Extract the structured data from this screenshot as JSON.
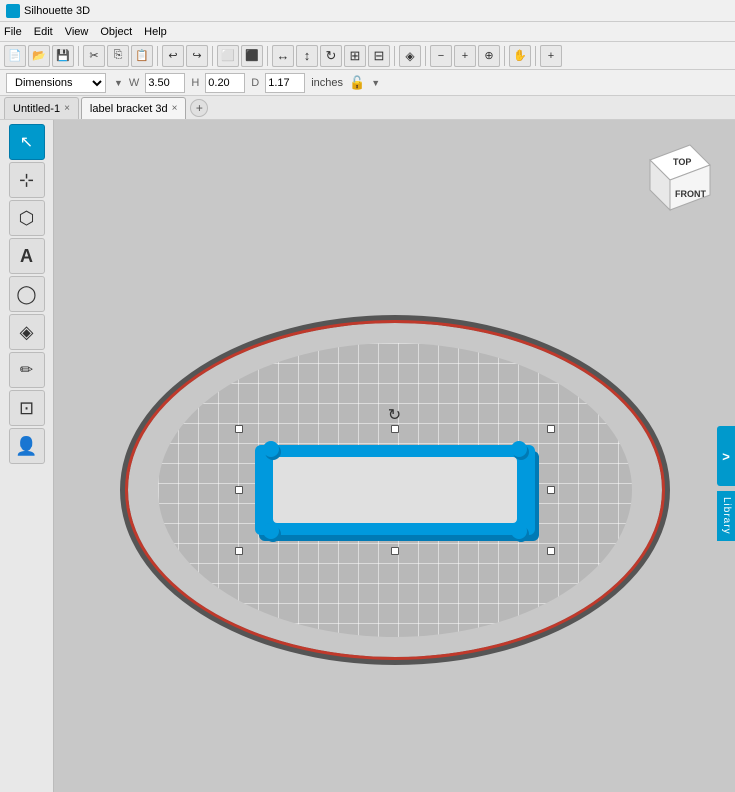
{
  "app": {
    "title": "Silhouette 3D",
    "icon": "S3D"
  },
  "menu": {
    "items": [
      "File",
      "Edit",
      "View",
      "Object",
      "Help"
    ]
  },
  "toolbar": {
    "buttons": [
      {
        "name": "new",
        "icon": "📄"
      },
      {
        "name": "open",
        "icon": "📂"
      },
      {
        "name": "save",
        "icon": "💾"
      },
      {
        "name": "cut",
        "icon": "✂"
      },
      {
        "name": "copy",
        "icon": "⎘"
      },
      {
        "name": "paste",
        "icon": "📋"
      },
      {
        "name": "undo",
        "icon": "↩"
      },
      {
        "name": "redo",
        "icon": "↪"
      },
      {
        "name": "select-rect",
        "icon": "⬜"
      },
      {
        "name": "select-all",
        "icon": "⬛"
      },
      {
        "name": "mirror-h",
        "icon": "↔"
      },
      {
        "name": "mirror-v",
        "icon": "↕"
      },
      {
        "name": "rotate",
        "icon": "↻"
      },
      {
        "name": "group",
        "icon": "⊞"
      },
      {
        "name": "ungroup",
        "icon": "⊟"
      },
      {
        "name": "align",
        "icon": "≡"
      },
      {
        "name": "zoom-out",
        "icon": "🔍"
      },
      {
        "name": "zoom-in",
        "icon": "🔎"
      },
      {
        "name": "fit",
        "icon": "⊕"
      },
      {
        "name": "pan",
        "icon": "✋"
      },
      {
        "name": "plus",
        "icon": "+"
      }
    ]
  },
  "dims_bar": {
    "dropdown_label": "Dimensions",
    "w_label": "W",
    "w_value": "3.50",
    "h_label": "H",
    "h_value": "0.20",
    "d_label": "D",
    "d_value": "1.17",
    "unit": "inches"
  },
  "tabs": [
    {
      "label": "Untitled-1",
      "active": false,
      "closeable": true
    },
    {
      "label": "label bracket 3d",
      "active": true,
      "closeable": true
    }
  ],
  "left_toolbar": {
    "tools": [
      {
        "name": "select",
        "icon": "↖",
        "active": true
      },
      {
        "name": "move",
        "icon": "⊹"
      },
      {
        "name": "cube",
        "icon": "⬡"
      },
      {
        "name": "text",
        "icon": "A"
      },
      {
        "name": "shape",
        "icon": "◯"
      },
      {
        "name": "extrude",
        "icon": "◈"
      },
      {
        "name": "pen",
        "icon": "✏"
      },
      {
        "name": "import",
        "icon": "⊡"
      },
      {
        "name": "person",
        "icon": "👤"
      }
    ]
  },
  "view_cube": {
    "top_label": "TOP",
    "front_label": "FRONT"
  },
  "library": {
    "button_label": "Library",
    "arrow": ">"
  },
  "object": {
    "name": "label bracket 3d"
  }
}
